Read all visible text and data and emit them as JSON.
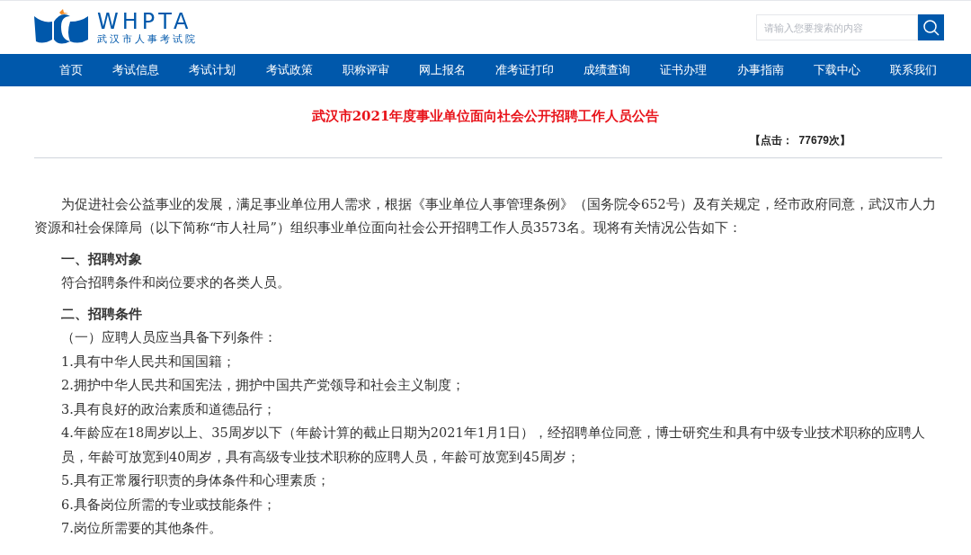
{
  "header": {
    "logo": {
      "letters": "WHPTA",
      "subtitle": "武汉市人事考试院"
    },
    "search": {
      "placeholder": "请输入您要搜索的内容"
    }
  },
  "nav": [
    "首页",
    "考试信息",
    "考试计划",
    "考试政策",
    "职称评审",
    "网上报名",
    "准考证打印",
    "成绩查询",
    "证书办理",
    "办事指南",
    "下载中心",
    "联系我们"
  ],
  "article": {
    "title": "武汉市2021年度事业单位面向社会公开招聘工作人员公告",
    "hits": "【点击：  77679次】",
    "blocks": [
      {
        "kind": "para",
        "text": "为促进社会公益事业的发展，满足事业单位用人需求，根据《事业单位人事管理条例》（国务院令652号）及有关规定，经市政府同意，武汉市人力资源和社会保障局（以下简称“市人社局”）组织事业单位面向社会公开招聘工作人员3573名。现将有关情况公告如下："
      },
      {
        "kind": "heading",
        "text": "一、招聘对象"
      },
      {
        "kind": "item",
        "text": "符合招聘条件和岗位要求的各类人员。"
      },
      {
        "kind": "heading",
        "text": "二、招聘条件"
      },
      {
        "kind": "item",
        "text": "（一）应聘人员应当具备下列条件："
      },
      {
        "kind": "item",
        "text": "1.具有中华人民共和国国籍；"
      },
      {
        "kind": "item",
        "text": "2.拥护中华人民共和国宪法，拥护中国共产党领导和社会主义制度；"
      },
      {
        "kind": "item",
        "text": "3.具有良好的政治素质和道德品行；"
      },
      {
        "kind": "item",
        "text": "4.年龄应在18周岁以上、35周岁以下（年龄计算的截止日期为2021年1月1日），经招聘单位同意，博士研究生和具有中级专业技术职称的应聘人员，年龄可放宽到40周岁，具有高级专业技术职称的应聘人员，年龄可放宽到45周岁；"
      },
      {
        "kind": "item",
        "text": "5.具有正常履行职责的身体条件和心理素质；"
      },
      {
        "kind": "item",
        "text": "6.具备岗位所需的专业或技能条件；"
      },
      {
        "kind": "item",
        "text": "7.岗位所需要的其他条件。"
      }
    ]
  }
}
